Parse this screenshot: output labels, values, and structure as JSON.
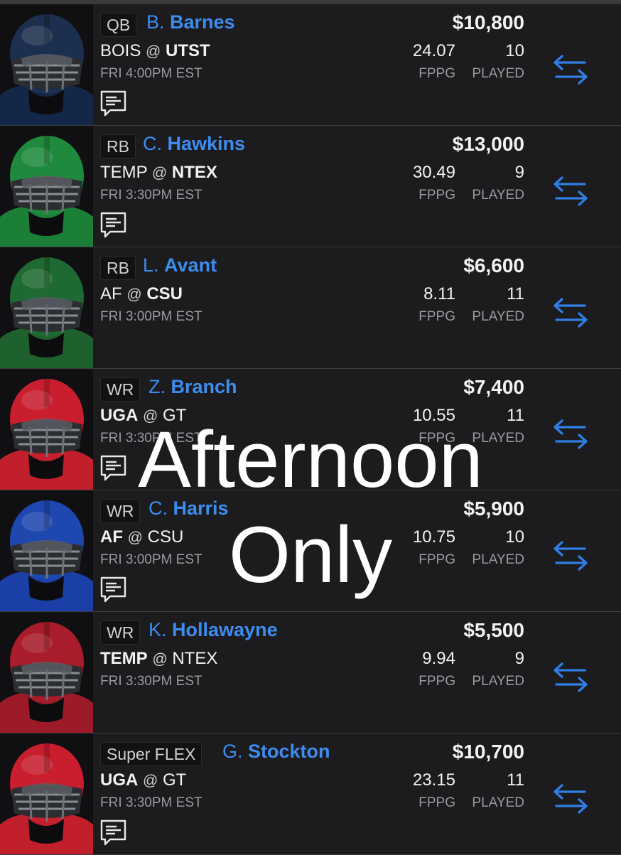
{
  "labels": {
    "fppg": "FPPG",
    "played": "PLAYED",
    "at": "@"
  },
  "overlay": {
    "line1": "Afternoon",
    "line2": "Only"
  },
  "players": [
    {
      "position": "QB",
      "first": "B.",
      "last": "Barnes",
      "salary": "$10,800",
      "away": "BOIS",
      "home": "UTST",
      "bold_team": "home",
      "time": "FRI 4:00PM EST",
      "fppg": "24.07",
      "played": "10",
      "has_notes": true,
      "helmet_color": "#1d2f4e",
      "jersey_color": "#132748"
    },
    {
      "position": "RB",
      "first": "C.",
      "last": "Hawkins",
      "salary": "$13,000",
      "away": "TEMP",
      "home": "NTEX",
      "bold_team": "home",
      "time": "FRI 3:30PM EST",
      "fppg": "30.49",
      "played": "9",
      "has_notes": true,
      "helmet_color": "#1f8a3e",
      "jersey_color": "#1c7f38"
    },
    {
      "position": "RB",
      "first": "L.",
      "last": "Avant",
      "salary": "$6,600",
      "away": "AF",
      "home": "CSU",
      "bold_team": "home",
      "time": "FRI 3:00PM EST",
      "fppg": "8.11",
      "played": "11",
      "has_notes": false,
      "helmet_color": "#1f6a32",
      "jersey_color": "#1e612e"
    },
    {
      "position": "WR",
      "first": "Z.",
      "last": "Branch",
      "salary": "$7,400",
      "away": "UGA",
      "home": "GT",
      "bold_team": "away",
      "time": "FRI 3:30PM EST",
      "fppg": "10.55",
      "played": "11",
      "has_notes": true,
      "helmet_color": "#c81e2e",
      "jersey_color": "#c21f2c"
    },
    {
      "position": "WR",
      "first": "C.",
      "last": "Harris",
      "salary": "$5,900",
      "away": "AF",
      "home": "CSU",
      "bold_team": "away",
      "time": "FRI 3:00PM EST",
      "fppg": "10.75",
      "played": "10",
      "has_notes": true,
      "helmet_color": "#1f47b0",
      "jersey_color": "#1a3fa6"
    },
    {
      "position": "WR",
      "first": "K.",
      "last": "Hollawayne",
      "salary": "$5,500",
      "away": "TEMP",
      "home": "NTEX",
      "bold_team": "away",
      "time": "FRI 3:30PM EST",
      "fppg": "9.94",
      "played": "9",
      "has_notes": false,
      "helmet_color": "#a81c2b",
      "jersey_color": "#9d1b29"
    },
    {
      "position": "Super FLEX",
      "first": "G.",
      "last": "Stockton",
      "salary": "$10,700",
      "away": "UGA",
      "home": "GT",
      "bold_team": "away",
      "time": "FRI 3:30PM EST",
      "fppg": "23.15",
      "played": "11",
      "has_notes": true,
      "helmet_color": "#c81e2e",
      "jersey_color": "#c21f2c"
    }
  ]
}
